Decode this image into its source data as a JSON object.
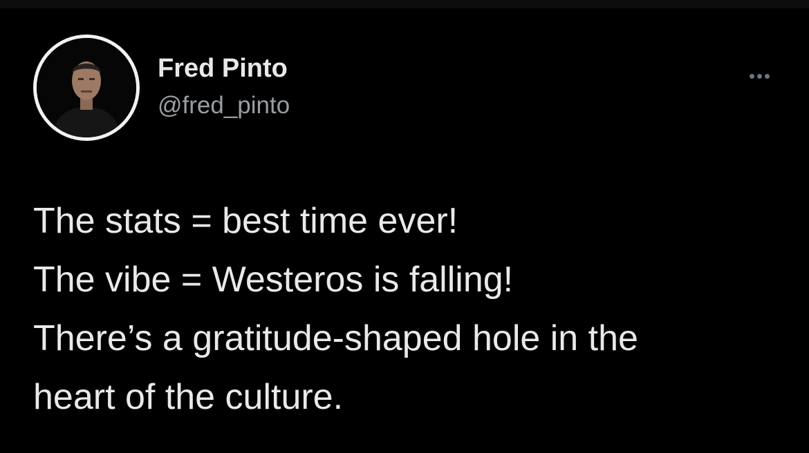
{
  "author": {
    "display_name": "Fred Pinto",
    "handle": "@fred_pinto",
    "avatar_icon": "profile-photo"
  },
  "more_icon": "more-horizontal-icon",
  "tweet": {
    "lines": [
      "The stats = best time ever!",
      "The vibe = Westeros is falling!",
      "There’s a gratitude-shaped hole in the",
      "heart of the culture."
    ]
  },
  "colors": {
    "background": "#000000",
    "primary_text": "#e7e9ea",
    "secondary_text": "#9a9ea2",
    "icon_gray": "#6e767d"
  }
}
